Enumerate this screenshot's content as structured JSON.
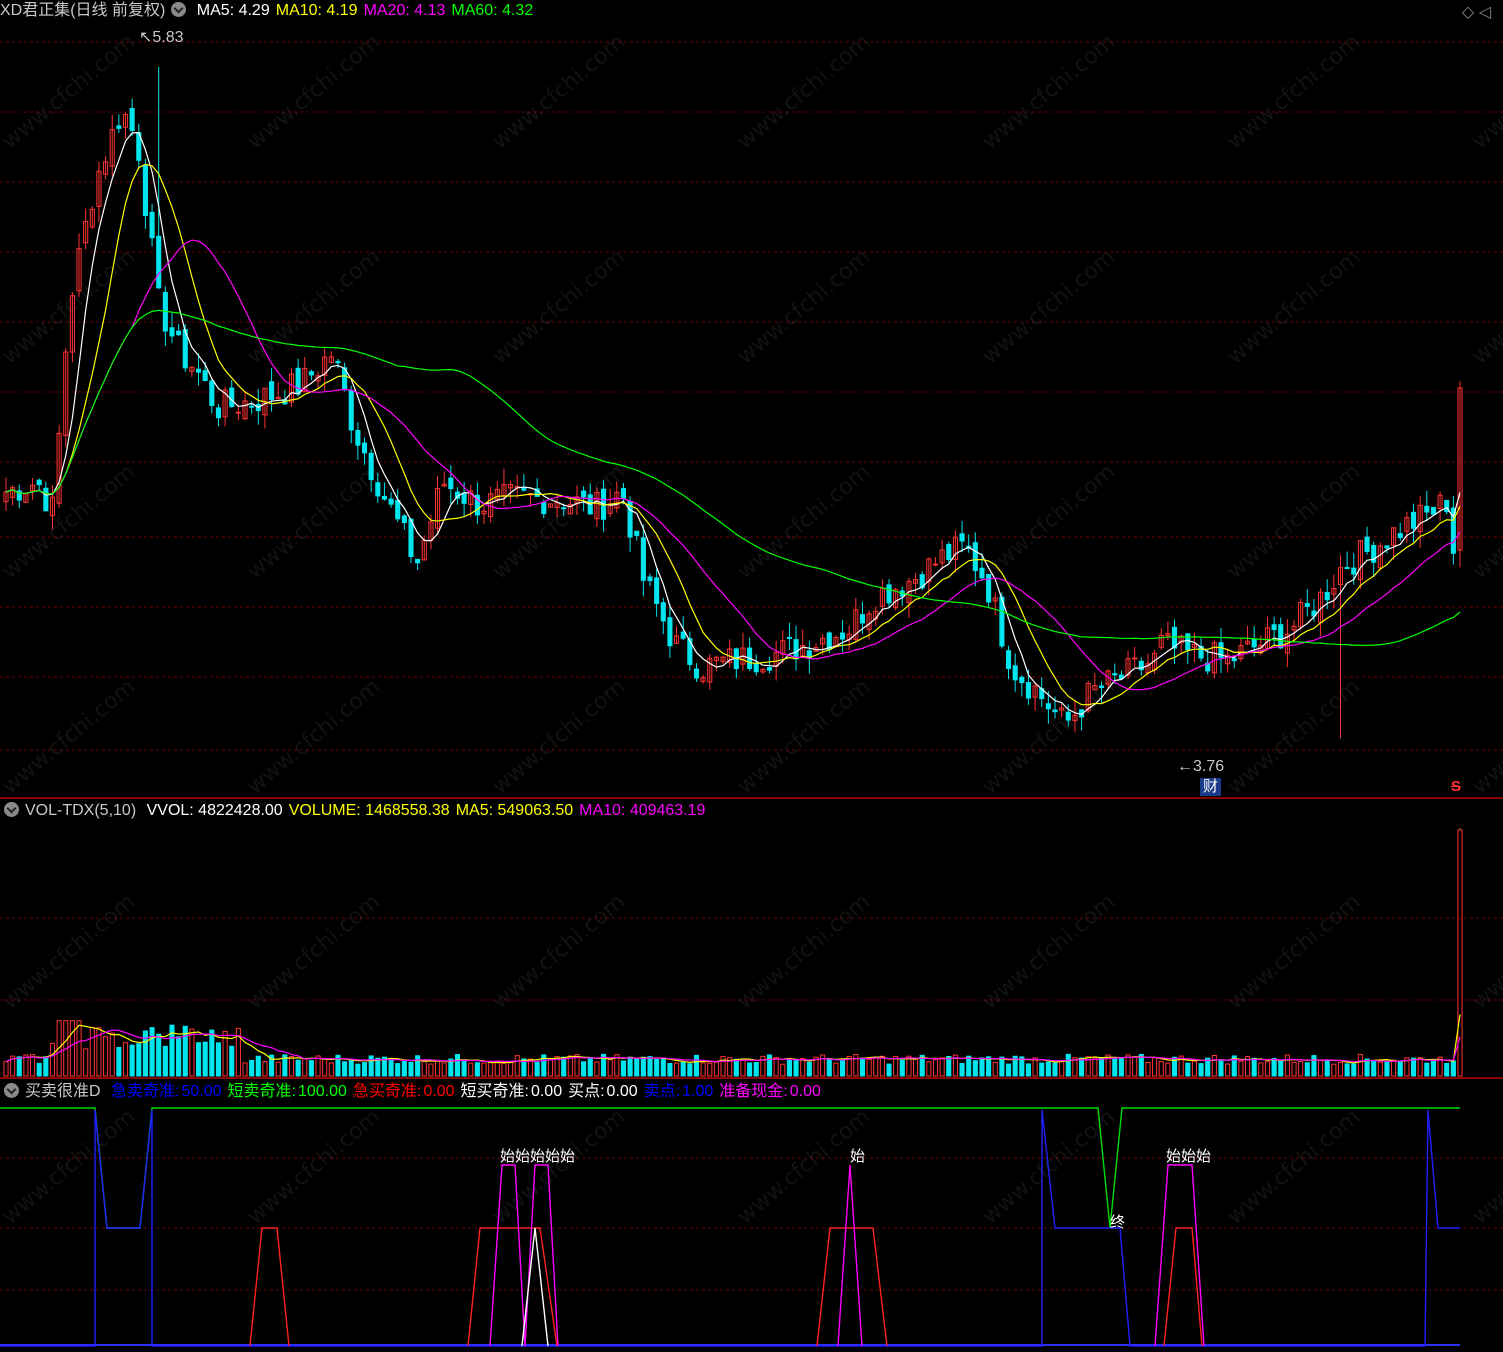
{
  "main": {
    "title": "XD君正集(日线 前复权)",
    "ma": [
      {
        "label": "MA5: 4.29",
        "color": "#ffffff"
      },
      {
        "label": "MA10: 4.19",
        "color": "#ffff00"
      },
      {
        "label": "MA20: 4.13",
        "color": "#ff00ff"
      },
      {
        "label": "MA60: 4.32",
        "color": "#00ff00"
      }
    ],
    "high_label": "5.83",
    "low_label": "3.76",
    "cai_badge": "财",
    "s_badge": "S"
  },
  "volume": {
    "title": "VOL-TDX(5,10)",
    "items": [
      {
        "label": "VVOL: 4822428.00",
        "color": "#ffffff"
      },
      {
        "label": "VOLUME: 1468558.38",
        "color": "#ffff00"
      },
      {
        "label": "MA5: 549063.50",
        "color": "#ffff00"
      },
      {
        "label": "MA10: 409463.19",
        "color": "#ff00ff"
      }
    ]
  },
  "indicator": {
    "title": "买卖很准D",
    "items": [
      {
        "name": "急卖奇准:",
        "value": "50.00",
        "color": "#0000ff"
      },
      {
        "name": "短卖奇准:",
        "value": "100.00",
        "color": "#00ff00"
      },
      {
        "name": "急买奇准:",
        "value": "0.00",
        "color": "#ff0000"
      },
      {
        "name": "短买奇准:",
        "value": "0.00",
        "color": "#ffffff"
      },
      {
        "name": "买点:",
        "value": "0.00",
        "color": "#ffffff"
      },
      {
        "name": "卖点:",
        "value": "1.00",
        "color": "#0000ff"
      },
      {
        "name": "准备现金:",
        "value": "0.00",
        "color": "#ff00ff"
      }
    ],
    "signal_labels": [
      {
        "text": "始始始始始",
        "bar": 88
      },
      {
        "text": "始",
        "bar": 147
      },
      {
        "text": "终",
        "bar": 191
      },
      {
        "text": "始始始",
        "bar": 203
      }
    ]
  },
  "watermark": "www.cfchi.com",
  "chart_data": {
    "type": "candlestick",
    "price_range": [
      3.6,
      5.95
    ],
    "high": {
      "value": 5.83,
      "bar": 23
    },
    "low": {
      "value": 3.76,
      "bar": 201
    },
    "volume_max": 1468558.38,
    "colors": {
      "up": "#ff3333",
      "down": "#00e5ee",
      "ma5": "#ffffff",
      "ma10": "#ffff00",
      "ma20": "#ff00ff",
      "ma60": "#00ff00",
      "vma5": "#ffff00",
      "vma10": "#ff00ff"
    }
  }
}
